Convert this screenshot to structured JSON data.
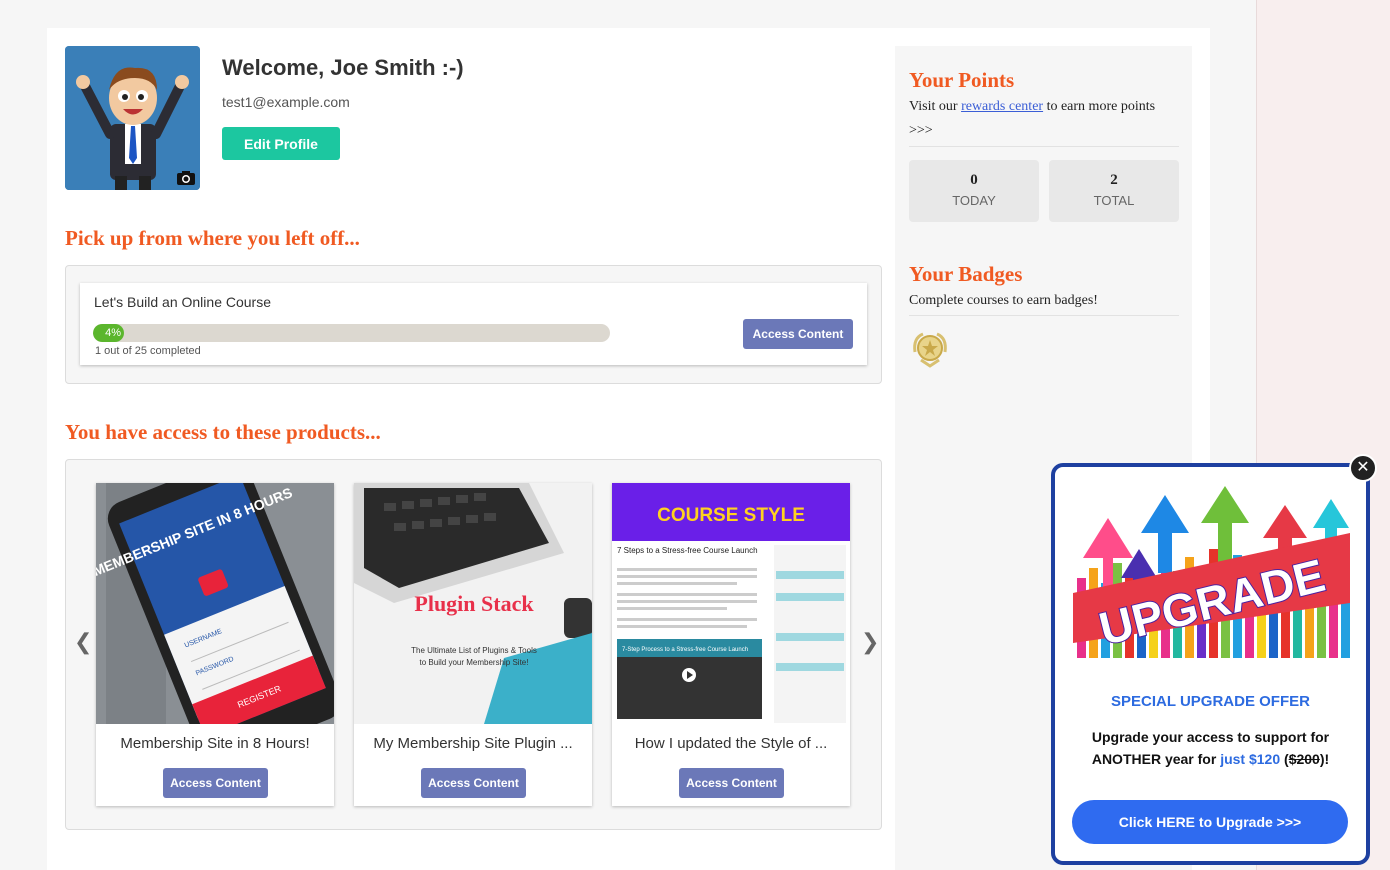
{
  "profile": {
    "welcome": "Welcome, Joe Smith :-)",
    "email": "test1@example.com",
    "edit_label": "Edit Profile"
  },
  "progress_section": {
    "heading": "Pick up from where you left off...",
    "course_title": "Let's Build an Online Course",
    "percent_label": "4%",
    "percent": 4,
    "completed_text": "1 out of 25 completed",
    "access_label": "Access Content"
  },
  "products_section": {
    "heading": "You have access to these products...",
    "prev_arrow": "❮",
    "next_arrow": "❯",
    "items": [
      {
        "name": "Membership Site in 8 Hours!",
        "access_label": "Access Content",
        "img_text": "MEMBERSHIP SITE IN 8 HOURS",
        "img_username": "USERNAME",
        "img_password": "PASSWORD",
        "img_register": "REGISTER"
      },
      {
        "name": "My Membership Site Plugin ...",
        "access_label": "Access Content",
        "img_title": "Plugin Stack",
        "img_sub1": "The Ultimate List of Plugins & Tools",
        "img_sub2": "to Build your Membership Site!"
      },
      {
        "name": "How I updated the Style of ...",
        "access_label": "Access Content",
        "img_banner": "COURSE STYLE",
        "img_heading": "7 Steps to a Stress-free Course Launch",
        "img_video": "7-Step Process to a Stress-free Course Launch"
      }
    ]
  },
  "points": {
    "heading": "Your Points",
    "text_before": "Visit our ",
    "link": "rewards center",
    "text_after": " to earn more points >>>",
    "today_value": "0",
    "today_label": "TODAY",
    "total_value": "2",
    "total_label": "TOTAL"
  },
  "badges": {
    "heading": "Your Badges",
    "text": "Complete courses to earn badges!"
  },
  "popup": {
    "close": "✕",
    "image_word": "UPGRADE",
    "title": "SPECIAL UPGRADE OFFER",
    "text_1": "Upgrade your access to support for ANOTHER year for ",
    "price_now": "just $120",
    "text_2": " (",
    "price_old": "$200",
    "text_3": ")!",
    "button": "Click HERE to Upgrade >>>"
  },
  "colors": {
    "accent_orange": "#f05a22",
    "teal": "#1cc7a0",
    "button_slate": "#6b78b8",
    "progress_green": "#5bb62d",
    "popup_blue": "#2f6bf0"
  }
}
